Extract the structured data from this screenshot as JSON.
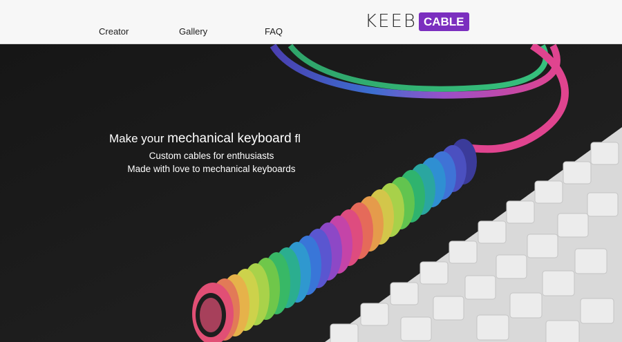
{
  "nav": {
    "items": [
      {
        "label": "Creator"
      },
      {
        "label": "Gallery"
      },
      {
        "label": "FAQ"
      }
    ]
  },
  "logo": {
    "keeb": "KEEB",
    "cable": "CABLE",
    "accent_color": "#7b2fbf"
  },
  "hero": {
    "headline_prefix": "Make your ",
    "headline_emphasis": "mechanical keyboard",
    "headline_suffix": " fl",
    "subtitle": "Custom cables for enthusiasts",
    "tagline": "Made with love to mechanical keyboards",
    "image_description_icon": "coiled-cable-keyboard-photo"
  }
}
